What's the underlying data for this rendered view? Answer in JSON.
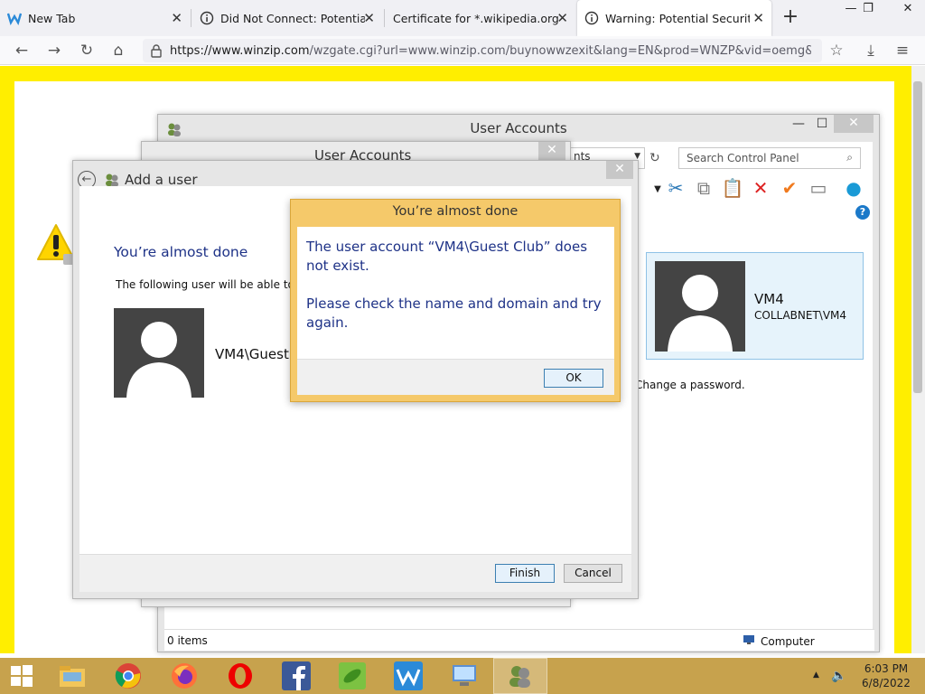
{
  "browser": {
    "tabs": [
      {
        "title": "New Tab",
        "icon": "winzip-favicon"
      },
      {
        "title": "Did Not Connect: Potential Se",
        "icon": "info-icon"
      },
      {
        "title": "Certificate for *.wikipedia.org",
        "icon": "none"
      },
      {
        "title": "Warning: Potential Security R",
        "icon": "info-icon",
        "active": true
      }
    ],
    "url_host": "https://www.winzip.com",
    "url_rest": "/wzgate.cgi?url=www.winzip.com/buynowwzexit&lang=EN&prod=WNZP&vid=oemg&x-at=p"
  },
  "page": {
    "frame_color": "#ffee00"
  },
  "control_panel": {
    "title": "User Accounts",
    "address_tail": "nts",
    "search_placeholder": "Search Control Panel",
    "user_tile": {
      "name": "VM4",
      "domain": "COLLABNET\\VM4"
    },
    "change_password_text": "Change a password.",
    "status_items": "0 items",
    "status_computer": "Computer"
  },
  "middle_window": {
    "title": "User Accounts"
  },
  "add_user": {
    "title": "Add a user",
    "heading": "You’re almost done",
    "following_text": "The following user will be able to sign in",
    "guest_name": "VM4\\Guest",
    "finish_label": "Finish",
    "cancel_label": "Cancel"
  },
  "message_box": {
    "title": "You’re almost done",
    "line1": "The user account “VM4\\Guest Club” does not exist.",
    "line2": "Please check the name and domain and try again.",
    "ok_label": "OK"
  },
  "taskbar": {
    "time": "6:03 PM",
    "date": "6/8/2022",
    "color": "#c7a24d",
    "apps": [
      "file-explorer",
      "chrome",
      "firefox",
      "opera",
      "facebook",
      "peapod",
      "winzip",
      "control-panel",
      "user-accounts"
    ]
  }
}
